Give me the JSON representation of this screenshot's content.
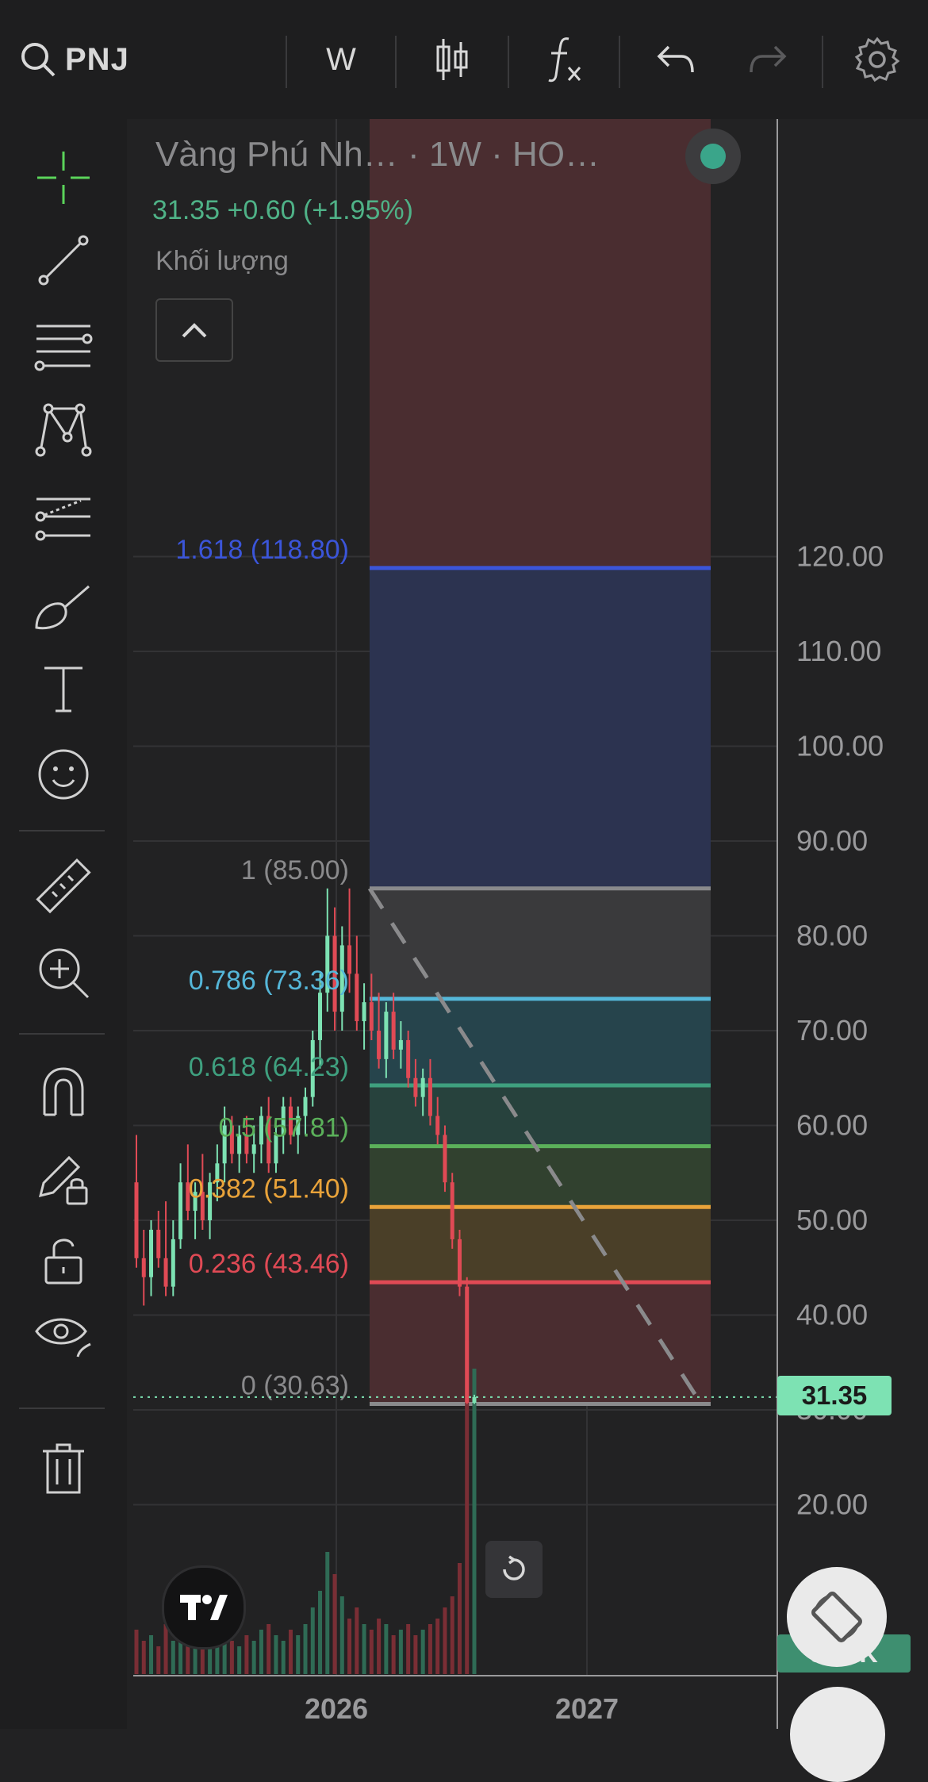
{
  "toolbar": {
    "symbol": "PNJ",
    "interval": "W"
  },
  "legend": {
    "title": "Vàng Phú Nh…  · 1W · HO…",
    "values": "31.35 +0.60 (+1.95%)",
    "volume_label": "Khối lượng"
  },
  "price_axis": {
    "labels": [
      "120.00",
      "110.00",
      "100.00",
      "90.00",
      "80.00",
      "70.00",
      "60.00",
      "50.00",
      "40.00",
      "30.00",
      "20.00"
    ],
    "current_price": "31.35",
    "volume_value": "5.12K"
  },
  "time_axis": {
    "labels": [
      "2026",
      "2027"
    ]
  },
  "fib_levels": [
    {
      "label": "1.618 (118.80)",
      "price": 118.8,
      "color": "#3b55d9",
      "fill": "#2c3350"
    },
    {
      "label": "1 (85.00)",
      "price": 85.0,
      "color": "#8a8a8c",
      "fill": "#3a3a3c"
    },
    {
      "label": "0.786 (73.36)",
      "price": 73.36,
      "color": "#55b7d9",
      "fill": "#26444c"
    },
    {
      "label": "0.618 (64.23)",
      "price": 64.23,
      "color": "#3fa07f",
      "fill": "#27423d"
    },
    {
      "label": "0.5 (57.81)",
      "price": 57.81,
      "color": "#5bb05a",
      "fill": "#31412f"
    },
    {
      "label": "0.382 (51.40)",
      "price": 51.4,
      "color": "#e9a33a",
      "fill": "#4a3f28"
    },
    {
      "label": "0.236 (43.46)",
      "price": 43.46,
      "color": "#e04a55",
      "fill": "#4a2d30"
    },
    {
      "label": "0 (30.63)",
      "price": 30.63,
      "color": "#8a8a8c",
      "fill": ""
    }
  ],
  "colors": {
    "up": "#7de2b3",
    "down": "#e04a55",
    "background": "#222223"
  },
  "icons": {
    "left_tools": [
      "crosshair-icon",
      "trend-line-icon",
      "fib-retracement-icon",
      "pattern-icon",
      "projection-icon",
      "brush-icon",
      "text-icon",
      "emoji-icon",
      "ruler-icon",
      "zoom-in-icon",
      "magnet-icon",
      "lock-drawing-icon",
      "unlock-icon",
      "eye-icon",
      "trash-icon"
    ]
  },
  "chart_data": {
    "type": "candlestick",
    "x_labels": [
      "2026",
      "2027"
    ],
    "ylim": [
      20,
      125
    ],
    "last_price": 31.35,
    "candles": [
      {
        "o": 54,
        "h": 59,
        "l": 45,
        "c": 46
      },
      {
        "o": 46,
        "h": 49,
        "l": 41,
        "c": 44
      },
      {
        "o": 44,
        "h": 50,
        "l": 42,
        "c": 49
      },
      {
        "o": 49,
        "h": 51,
        "l": 45,
        "c": 46
      },
      {
        "o": 46,
        "h": 52,
        "l": 42,
        "c": 43
      },
      {
        "o": 43,
        "h": 50,
        "l": 42,
        "c": 48
      },
      {
        "o": 48,
        "h": 56,
        "l": 47,
        "c": 54
      },
      {
        "o": 54,
        "h": 58,
        "l": 50,
        "c": 51
      },
      {
        "o": 51,
        "h": 54,
        "l": 48,
        "c": 53
      },
      {
        "o": 53,
        "h": 57,
        "l": 49,
        "c": 50
      },
      {
        "o": 50,
        "h": 55,
        "l": 48,
        "c": 54
      },
      {
        "o": 54,
        "h": 58,
        "l": 52,
        "c": 56
      },
      {
        "o": 56,
        "h": 62,
        "l": 54,
        "c": 60
      },
      {
        "o": 60,
        "h": 61,
        "l": 56,
        "c": 57
      },
      {
        "o": 57,
        "h": 60,
        "l": 55,
        "c": 59
      },
      {
        "o": 59,
        "h": 61,
        "l": 56,
        "c": 57
      },
      {
        "o": 57,
        "h": 60,
        "l": 55,
        "c": 58
      },
      {
        "o": 58,
        "h": 62,
        "l": 56,
        "c": 61
      },
      {
        "o": 61,
        "h": 63,
        "l": 55,
        "c": 56
      },
      {
        "o": 56,
        "h": 60,
        "l": 55,
        "c": 59
      },
      {
        "o": 59,
        "h": 63,
        "l": 57,
        "c": 62
      },
      {
        "o": 62,
        "h": 63,
        "l": 58,
        "c": 59
      },
      {
        "o": 59,
        "h": 62,
        "l": 57,
        "c": 61
      },
      {
        "o": 61,
        "h": 64,
        "l": 59,
        "c": 63
      },
      {
        "o": 63,
        "h": 70,
        "l": 62,
        "c": 69
      },
      {
        "o": 69,
        "h": 76,
        "l": 66,
        "c": 74
      },
      {
        "o": 74,
        "h": 85,
        "l": 72,
        "c": 80
      },
      {
        "o": 80,
        "h": 83,
        "l": 70,
        "c": 72
      },
      {
        "o": 72,
        "h": 81,
        "l": 70,
        "c": 79
      },
      {
        "o": 79,
        "h": 85,
        "l": 74,
        "c": 76
      },
      {
        "o": 76,
        "h": 80,
        "l": 70,
        "c": 71
      },
      {
        "o": 71,
        "h": 75,
        "l": 68,
        "c": 73
      },
      {
        "o": 73,
        "h": 76,
        "l": 69,
        "c": 70
      },
      {
        "o": 70,
        "h": 74,
        "l": 66,
        "c": 67
      },
      {
        "o": 67,
        "h": 73,
        "l": 65,
        "c": 72
      },
      {
        "o": 72,
        "h": 74,
        "l": 67,
        "c": 68
      },
      {
        "o": 68,
        "h": 71,
        "l": 66,
        "c": 69
      },
      {
        "o": 69,
        "h": 70,
        "l": 64,
        "c": 65
      },
      {
        "o": 65,
        "h": 67,
        "l": 62,
        "c": 63
      },
      {
        "o": 63,
        "h": 66,
        "l": 61,
        "c": 65
      },
      {
        "o": 65,
        "h": 67,
        "l": 60,
        "c": 61
      },
      {
        "o": 61,
        "h": 63,
        "l": 58,
        "c": 59
      },
      {
        "o": 59,
        "h": 60,
        "l": 53,
        "c": 54
      },
      {
        "o": 54,
        "h": 55,
        "l": 47,
        "c": 48
      },
      {
        "o": 48,
        "h": 49,
        "l": 42,
        "c": 43
      },
      {
        "o": 43,
        "h": 44,
        "l": 30.63,
        "c": 30.75
      },
      {
        "o": 30.75,
        "h": 31.6,
        "l": 30.63,
        "c": 31.35
      }
    ],
    "volumes": [
      8,
      6,
      7,
      5,
      9,
      6,
      8,
      5,
      7,
      6,
      5,
      7,
      8,
      6,
      5,
      7,
      6,
      8,
      9,
      7,
      6,
      8,
      7,
      9,
      12,
      15,
      22,
      18,
      14,
      10,
      12,
      9,
      8,
      10,
      9,
      7,
      8,
      9,
      7,
      8,
      9,
      10,
      12,
      14,
      20,
      60,
      55
    ]
  }
}
